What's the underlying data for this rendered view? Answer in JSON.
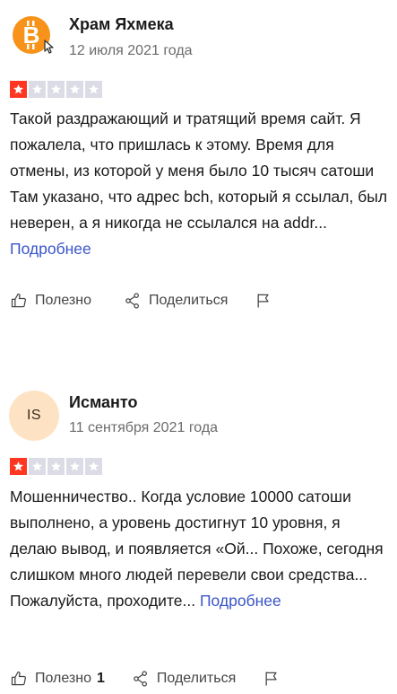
{
  "reviews": [
    {
      "author": "Храм Яхмека",
      "date": "12 июля 2021 года",
      "avatar": {
        "type": "icon",
        "icon": "bitcoin-icon",
        "color": "#f7931a"
      },
      "rating": 1,
      "max_rating": 5,
      "text": "Такой раздражающий и тратящий время сайт. Я пожалела, что пришлась к этому. Время для отмены, из которой у меня было 10 тысяч сатоши Там указано, что адрес bch, который я ссылал, был неверен, а я никогда не ссылался на addr...",
      "more_label": "Подробнее",
      "helpful_label": "Полезно",
      "helpful_count": "",
      "share_label": "Поделиться"
    },
    {
      "author": "Исманто",
      "date": "11 сентября 2021 года",
      "avatar": {
        "type": "initials",
        "initials": "IS",
        "color": "#fde3c4"
      },
      "rating": 1,
      "max_rating": 5,
      "text": "Мошенничество.. Когда условие 10000 сатоши выполнено, а уровень достигнут 10 уровня, я делаю вывод, и появляется «Ой... Похоже, сегодня слишком много людей перевели свои средства... Пожалуйста, проходите...",
      "more_label": "Подробнее",
      "helpful_label": "Полезно",
      "helpful_count": "1",
      "share_label": "Поделиться"
    }
  ],
  "colors": {
    "star_on": "#ff3722",
    "star_off": "#dcdce6",
    "link": "#3a55c8"
  }
}
